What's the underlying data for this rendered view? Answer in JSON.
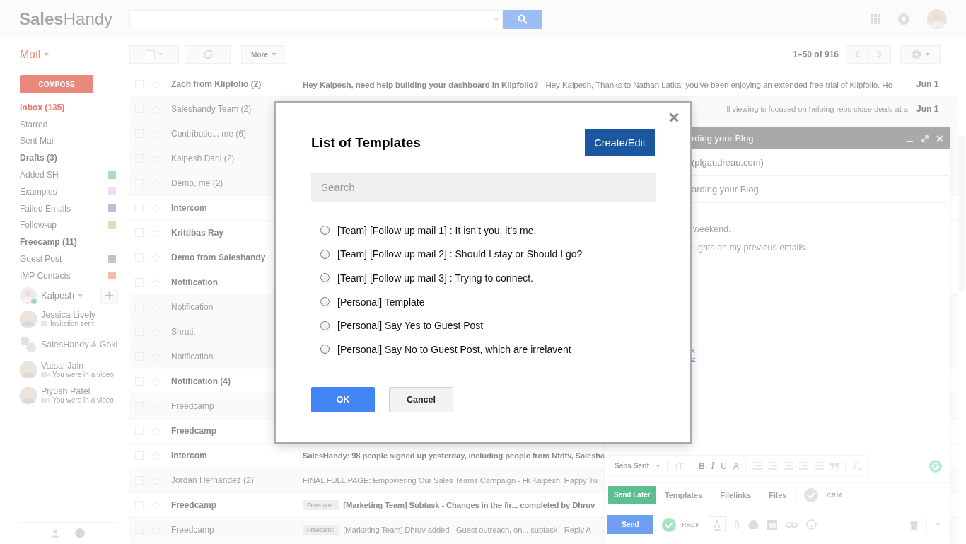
{
  "header": {
    "logo": {
      "bold": "Sales",
      "light": "Handy"
    }
  },
  "toolbar": {
    "app_label": "Mail",
    "more": "More",
    "pagination": "1–50 of 916"
  },
  "sidebar": {
    "compose": "COMPOSE",
    "folders": [
      {
        "label": "Inbox (135)",
        "selected": true,
        "bold": true
      },
      {
        "label": "Starred",
        "selected": false,
        "bold": false
      },
      {
        "label": "Sent Mail",
        "selected": false,
        "bold": false
      },
      {
        "label": "Drafts (3)",
        "selected": false,
        "bold": true
      },
      {
        "label": "Added SH",
        "selected": false,
        "bold": false,
        "color": "#a9dcc3"
      },
      {
        "label": "Examples",
        "selected": false,
        "bold": false,
        "color": "#e4e3fb"
      },
      {
        "label": "Failed Emails",
        "selected": false,
        "bold": false,
        "color": "#c4bdd3"
      },
      {
        "label": "Follow-up",
        "selected": false,
        "bold": false,
        "color": "#ead9c4"
      },
      {
        "label": "Freecamp (11)",
        "selected": false,
        "bold": true
      },
      {
        "label": "Guest Post",
        "selected": false,
        "bold": false,
        "color": "#c4bdd3"
      },
      {
        "label": "IMP Contacts",
        "selected": false,
        "bold": false,
        "color": "#f8b9b1"
      }
    ],
    "chat": {
      "me": "Kalpesh",
      "contacts": [
        {
          "name": "Jessica Lively",
          "status": "Invitation sent",
          "kind": "invite"
        },
        {
          "name": "SalesHandy & Gokl",
          "kind": "group"
        },
        {
          "name": "Vatsal Jain",
          "status": "You were in a video",
          "kind": "video"
        },
        {
          "name": "Piyush Patel",
          "status": "You were in a video",
          "kind": "video"
        }
      ]
    }
  },
  "email_list": {
    "rows": [
      {
        "sender": "Zach from Klipfolio (2)",
        "unread": true,
        "subject": "**Hey Kalpesh, need help building your dashboard in Klipfolio?** - Hey Kalpesh, Thanks to Nathan Latka, you've been enjoying an extended free trial of Klipfolio. Ho",
        "date": "Jun 1"
      },
      {
        "sender": "Saleshandy Team (2)",
        "unread": false,
        "subject": "ll viewing is focused on helping reps close deals at a",
        "clipped_left": true,
        "date": "Jun 1"
      },
      {
        "sender": "Contributio... me (6)",
        "unread": false
      },
      {
        "sender": "Kalpesh Darji (2)",
        "unread": false
      },
      {
        "sender": "Demo, me (2)",
        "unread": false
      },
      {
        "sender": "Intercom",
        "unread": true
      },
      {
        "sender": "Krittibas Ray",
        "unread": true
      },
      {
        "sender": "Demo from Saleshandy",
        "unread": true
      },
      {
        "sender": "Notification",
        "unread": true
      },
      {
        "sender": "Notification",
        "unread": false
      },
      {
        "sender": "Shruti.",
        "unread": false
      },
      {
        "sender": "Notification",
        "unread": false
      },
      {
        "sender": "Notification (4)",
        "unread": true
      },
      {
        "sender": "Freedcamp",
        "unread": false
      },
      {
        "sender": "Freedcamp",
        "unread": true
      },
      {
        "sender": "Intercom",
        "unread": true,
        "subject": "**SalesHandy: 98 people signed up yesterday, including people from Ntdtv, Salesha**"
      },
      {
        "sender": "Jordan Hernandez (2)",
        "unread": false,
        "subject": "FINAL FULL PAGE: Empowering Our Sales Teams Campaign - Hi Kalpesh, Happy Tu"
      },
      {
        "sender": "Freedcamp",
        "unread": true,
        "tag": "Freecamp",
        "subject": "**[Marketing Team] Subtask - Changes in the fir... completed by Dhruv**"
      },
      {
        "sender": "Freedcamp",
        "unread": false,
        "tag": "Freecamp",
        "subject": "[Marketing Team] Dhruv added - Guest outreach, on... subtask - Reply A"
      }
    ]
  },
  "compose_window": {
    "title": "rding your Blog",
    "recipient": "(plgaudreau.com)",
    "subject": "arding your Blog",
    "body": [
      "weekend.",
      "ughts on my previous emails."
    ],
    "links": [
      "y",
      "e"
    ],
    "font": "Sans Serif",
    "format_letters": [
      "B",
      "I",
      "U",
      "A"
    ],
    "actions": [
      "Send Later",
      "Templates",
      "Filelinks",
      "Files",
      "CRM"
    ],
    "send": "Send",
    "track": "TRACK"
  },
  "modal": {
    "title": "List of Templates",
    "create_button": "Create/Edit",
    "search": {
      "placeholder": "Search"
    },
    "templates": [
      {
        "label": "[Team] [Follow up mail 1] : It isn’t you, it’s me.",
        "selected": false
      },
      {
        "label": "[Team] [Follow up mail 2] : Should I stay or Should I go?",
        "selected": false
      },
      {
        "label": "[Team] [Follow up mail 3] : Trying to connect.",
        "selected": false
      },
      {
        "label": "[Personal] Template",
        "selected": false
      },
      {
        "label": "[Personal] Say Yes to Guest Post",
        "selected": false
      },
      {
        "label": "[Personal] Say No to Guest Post, which are irrelavent",
        "selected": false
      }
    ],
    "ok": "OK",
    "cancel": "Cancel"
  }
}
